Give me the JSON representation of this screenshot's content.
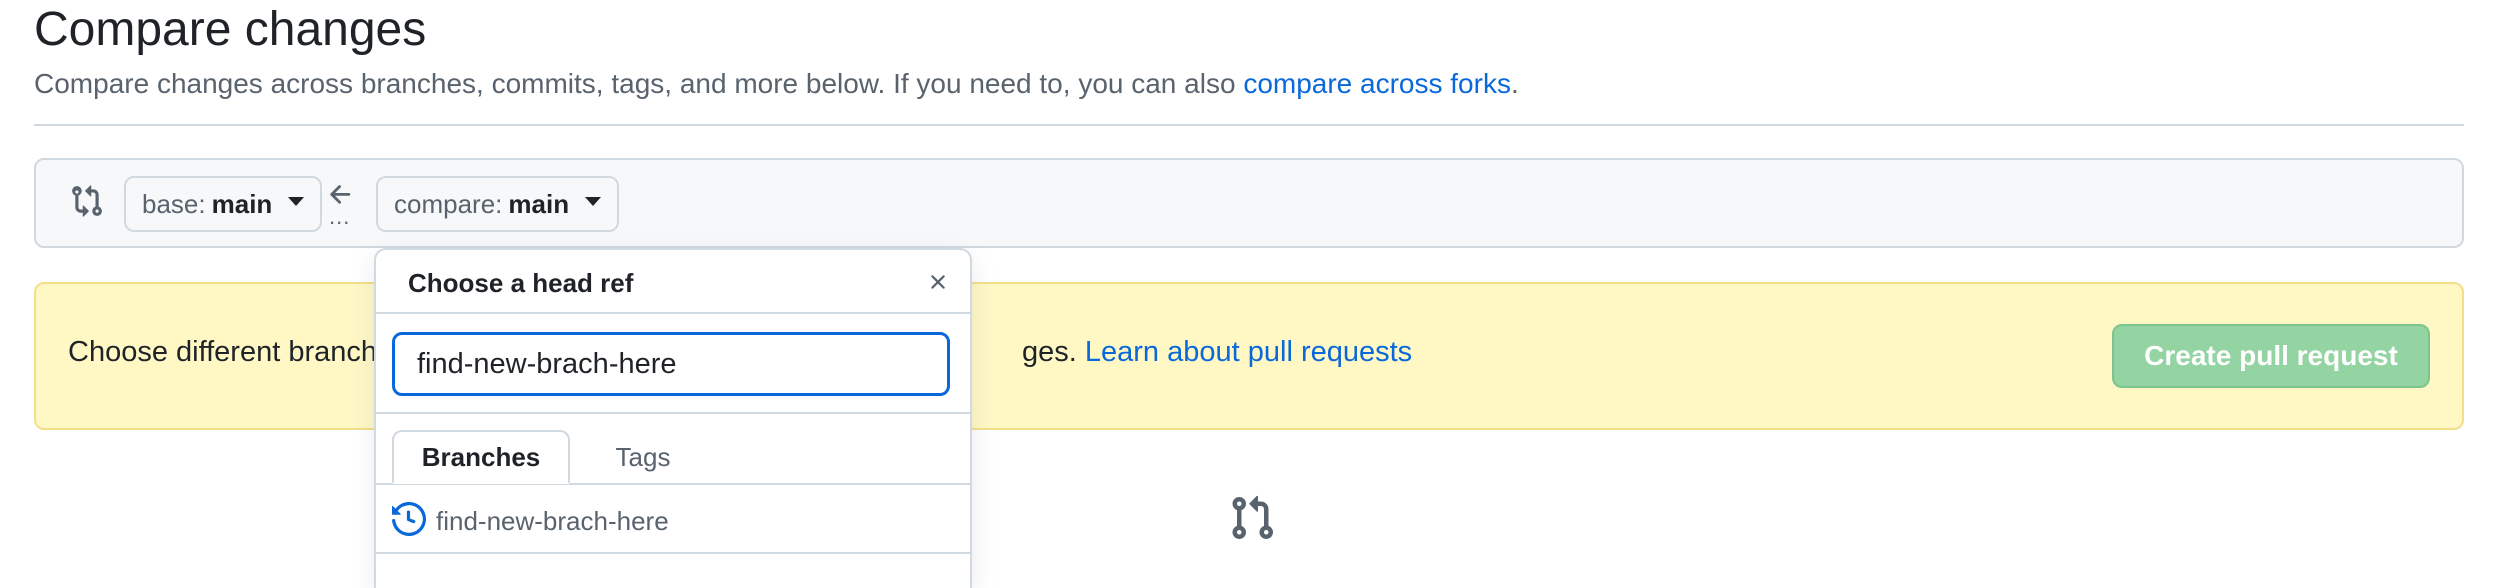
{
  "header": {
    "title": "Compare changes",
    "subtitle_prefix": "Compare changes across branches, commits, tags, and more below. If you need to, you can also ",
    "subtitle_link": "compare across forks",
    "subtitle_suffix": "."
  },
  "range_editor": {
    "base_label": "base:",
    "base_value": "main",
    "compare_label": "compare:",
    "compare_value": "main",
    "dots": "..."
  },
  "notice": {
    "text": "Choose different branch",
    "text_fragment": "ges.",
    "link": "Learn about pull requests",
    "create_button": "Create pull request"
  },
  "dropdown": {
    "title": "Choose a head ref",
    "filter_value": "find-new-brach-here",
    "tabs": [
      {
        "label": "Branches",
        "active": true
      },
      {
        "label": "Tags",
        "active": false
      }
    ],
    "items": [
      {
        "label": "find-new-brach-here",
        "icon": "history-icon"
      }
    ]
  },
  "colors": {
    "link": "#0969da",
    "notice_bg": "#fff8c5",
    "create_button_bg": "#94d3a2",
    "focus_border": "#0969da"
  }
}
